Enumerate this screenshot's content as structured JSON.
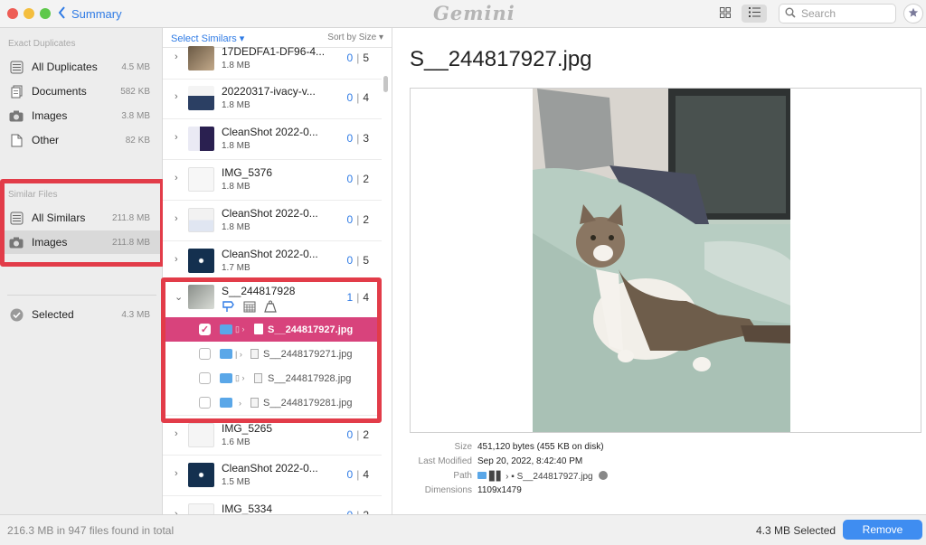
{
  "titlebar": {
    "back_label": "Summary",
    "app_name": "Gemini",
    "search_placeholder": "Search"
  },
  "sidebar": {
    "exact_header": "Exact Duplicates",
    "exact_items": [
      {
        "label": "All Duplicates",
        "size": "4.5 MB",
        "icon": "drive-icon"
      },
      {
        "label": "Documents",
        "size": "582 KB",
        "icon": "documents-icon"
      },
      {
        "label": "Images",
        "size": "3.8 MB",
        "icon": "camera-icon"
      },
      {
        "label": "Other",
        "size": "82 KB",
        "icon": "file-icon"
      }
    ],
    "similar_header": "Similar Files",
    "similar_items": [
      {
        "label": "All Similars",
        "size": "211.8 MB",
        "icon": "drive-icon"
      },
      {
        "label": "Images",
        "size": "211.8 MB",
        "icon": "camera-icon",
        "selected": true
      }
    ],
    "selected_item": {
      "label": "Selected",
      "size": "4.3 MB",
      "icon": "check-circle-icon"
    }
  },
  "middle": {
    "select_similars": "Select Similars ▾",
    "sort_by": "Sort by Size ▾",
    "groups_top": [
      {
        "name": "17DEDFA1-DF96-4...",
        "size": "1.8 MB",
        "selected": "0",
        "total": "5"
      },
      {
        "name": "20220317-ivacy-v...",
        "size": "1.8 MB",
        "selected": "0",
        "total": "4"
      },
      {
        "name": "CleanShot 2022-0...",
        "size": "1.8 MB",
        "selected": "0",
        "total": "3"
      },
      {
        "name": "IMG_5376",
        "size": "1.8 MB",
        "selected": "0",
        "total": "2"
      },
      {
        "name": "CleanShot 2022-0...",
        "size": "1.8 MB",
        "selected": "0",
        "total": "2"
      },
      {
        "name": "CleanShot 2022-0...",
        "size": "1.7 MB",
        "selected": "0",
        "total": "5"
      }
    ],
    "expanded_group": {
      "name": "S__244817928",
      "selected": "1",
      "total": "4"
    },
    "files": [
      {
        "name": "S__244817927.jpg",
        "checked": true
      },
      {
        "name": "S__2448179271.jpg",
        "checked": false
      },
      {
        "name": "S__244817928.jpg",
        "checked": false
      },
      {
        "name": "S__2448179281.jpg",
        "checked": false
      }
    ],
    "groups_bottom": [
      {
        "name": "IMG_5265",
        "size": "1.6 MB",
        "selected": "0",
        "total": "2"
      },
      {
        "name": "CleanShot 2022-0...",
        "size": "1.5 MB",
        "selected": "0",
        "total": "4"
      },
      {
        "name": "IMG_5334",
        "size": "",
        "selected": "0",
        "total": "2"
      }
    ]
  },
  "detail": {
    "title": "S__244817927.jpg",
    "meta": [
      {
        "key": "Size",
        "value": "451,120 bytes (455 KB on disk)"
      },
      {
        "key": "Last Modified",
        "value": "Sep 20, 2022, 8:42:40 PM"
      },
      {
        "key": "Path",
        "value": "▊▋ › ▪ S__244817927.jpg"
      },
      {
        "key": "Dimensions",
        "value": "1109x1479"
      }
    ]
  },
  "footer": {
    "summary": "216.3 MB in 947 files found in total",
    "selected_size": "4.3 MB Selected",
    "remove_label": "Remove"
  },
  "colors": {
    "accent": "#2f7be5",
    "highlight_row": "#d8437c",
    "annotation_box": "#e23c49",
    "remove_button": "#3f8df1"
  }
}
